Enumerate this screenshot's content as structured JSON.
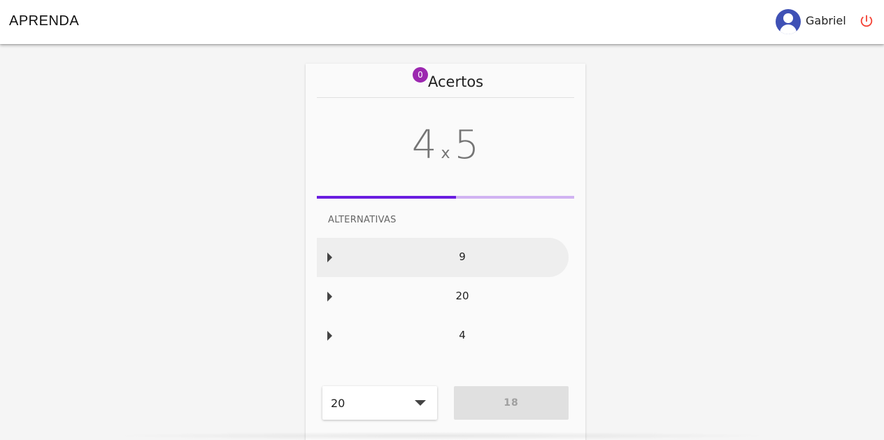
{
  "header": {
    "brand": "APRENDA",
    "user_name": "Gabriel",
    "avatar_icon": "account-circle-icon",
    "logout_icon": "power-icon",
    "accent": "#3f51b5",
    "logout_color": "#f44336"
  },
  "score": {
    "count": "0",
    "label": "Acertos",
    "badge_color": "#9c27b0"
  },
  "question": {
    "left": "4",
    "operator": "x",
    "right": "5"
  },
  "progress": {
    "value": 0.54,
    "fill_color": "#6a1ee0",
    "track_color": "#d1b3f2"
  },
  "alternatives": {
    "header": "ALTERNATIVAS",
    "items": [
      {
        "value": "9",
        "icon": "arrow-right-icon",
        "active": true
      },
      {
        "value": "20",
        "icon": "arrow-right-icon",
        "active": false
      },
      {
        "value": "4",
        "icon": "arrow-right-icon",
        "active": false
      }
    ]
  },
  "answer_select": {
    "selected": "20",
    "icon": "chevron-down-icon"
  },
  "submit_button": {
    "label": "18"
  }
}
